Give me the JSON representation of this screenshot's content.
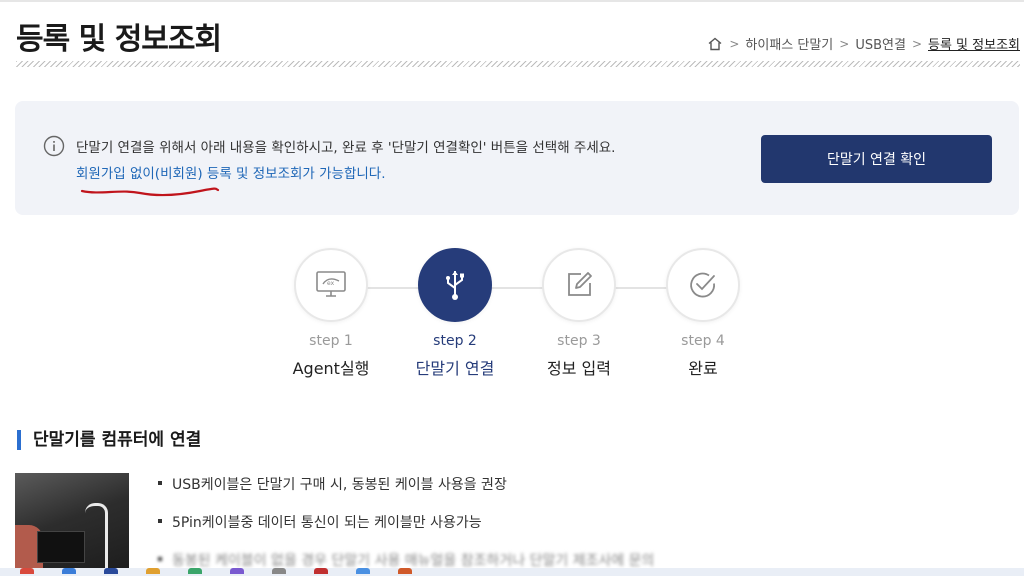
{
  "header": {
    "title": "등록 및 정보조회",
    "breadcrumb": [
      "하이패스 단말기",
      "USB연결",
      "등록 및 정보조회"
    ]
  },
  "notice": {
    "line1": "단말기 연결을 위해서 아래 내용을 확인하시고, 완료 후 '단말기 연결확인' 버튼을 선택해 주세요.",
    "line2": "회원가입 없이(비회원) 등록 및 정보조회가 가능합니다.",
    "confirm_label": "단말기 연결 확인"
  },
  "steps": [
    {
      "num": "step 1",
      "label": "Agent실행",
      "icon": "monitor-ex-icon",
      "active": false
    },
    {
      "num": "step 2",
      "label": "단말기 연결",
      "icon": "usb-icon",
      "active": true
    },
    {
      "num": "step 3",
      "label": "정보 입력",
      "icon": "edit-icon",
      "active": false
    },
    {
      "num": "step 4",
      "label": "완료",
      "icon": "check-circle-icon",
      "active": false
    }
  ],
  "section": {
    "title": "단말기를 컴퓨터에 연결",
    "bullets": [
      "USB케이블은 단말기 구매 시, 동봉된 케이블 사용을 권장",
      "5Pin케이블중 데이터 통신이 되는 케이블만 사용가능",
      "동봉된 케이블이 없을 경우 단말기 사용 매뉴얼을 참조하거나 단말기 제조사에 문의"
    ]
  },
  "colors": {
    "primary": "#22376e",
    "link": "#1f67b7",
    "accent_bar": "#2b6fd0",
    "notice_bg": "#f1f3f8",
    "annotation": "#c0141c"
  }
}
